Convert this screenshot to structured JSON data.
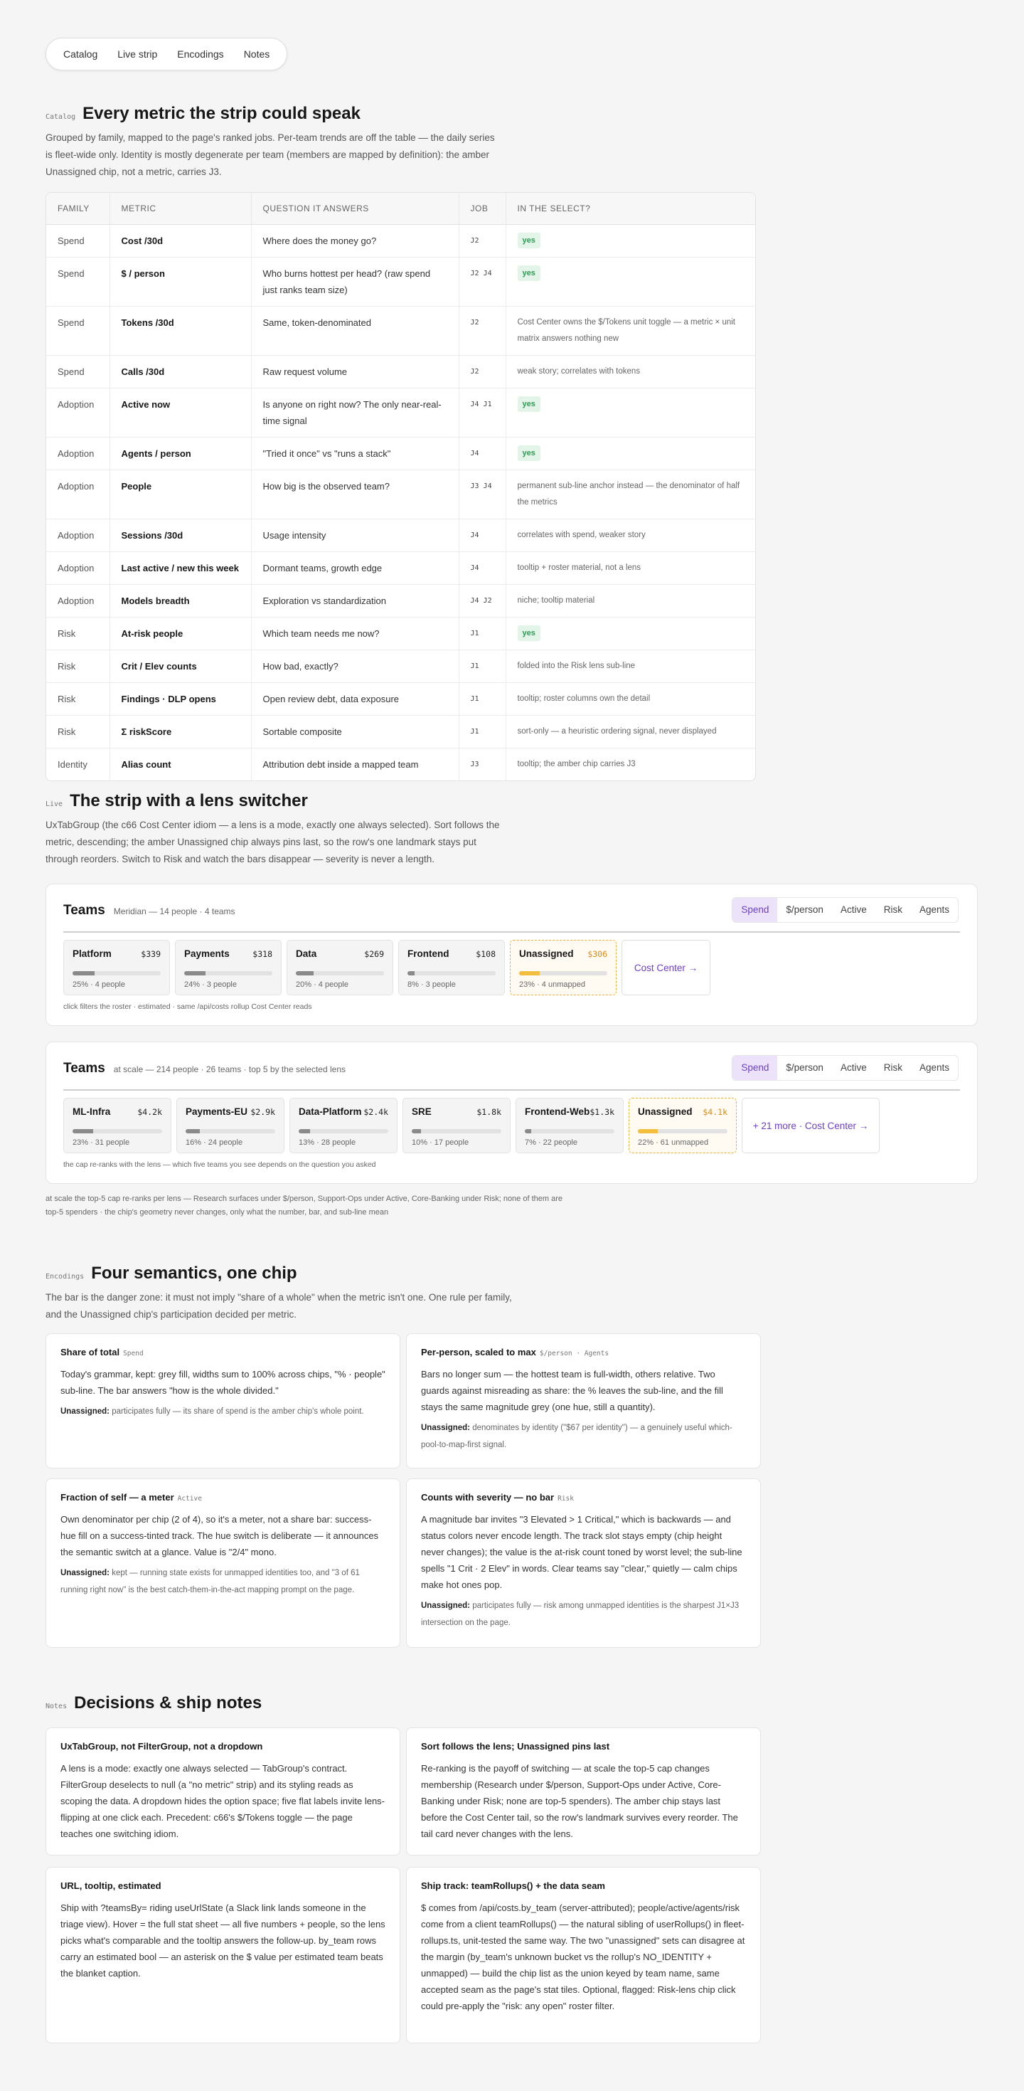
{
  "nav": [
    "Catalog",
    "Live strip",
    "Encodings",
    "Notes"
  ],
  "catalog": {
    "eyebrow": "Catalog",
    "title": "Every metric the strip could speak",
    "desc": "Grouped by family, mapped to the page's ranked jobs. Per-team trends are off the table — the daily series is fleet-wide only. Identity is mostly degenerate per team (members are mapped by definition): the amber Unassigned chip, not a metric, carries J3.",
    "headers": [
      "Family",
      "Metric",
      "Question it answers",
      "Job",
      "In the select?"
    ],
    "rows": [
      {
        "family": "Spend",
        "metric": "Cost /30d",
        "question": "Where does the money go?",
        "job": "J2",
        "select": "yes",
        "yes": true
      },
      {
        "family": "Spend",
        "metric": "$ / person",
        "question": "Who burns hottest per head? (raw spend just ranks team size)",
        "job": "J2 J4",
        "select": "yes",
        "yes": true
      },
      {
        "family": "Spend",
        "metric": "Tokens /30d",
        "question": "Same, token-denominated",
        "job": "J2",
        "select": "Cost Center owns the $/Tokens unit toggle — a metric × unit matrix answers nothing new",
        "yes": false
      },
      {
        "family": "Spend",
        "metric": "Calls /30d",
        "question": "Raw request volume",
        "job": "J2",
        "select": "weak story; correlates with tokens",
        "yes": false
      },
      {
        "family": "Adoption",
        "metric": "Active now",
        "question": "Is anyone on right now? The only near-real-time signal",
        "job": "J4 J1",
        "select": "yes",
        "yes": true
      },
      {
        "family": "Adoption",
        "metric": "Agents / person",
        "question": "\"Tried it once\" vs \"runs a stack\"",
        "job": "J4",
        "select": "yes",
        "yes": true
      },
      {
        "family": "Adoption",
        "metric": "People",
        "question": "How big is the observed team?",
        "job": "J3 J4",
        "select": "permanent sub-line anchor instead — the denominator of half the metrics",
        "yes": false
      },
      {
        "family": "Adoption",
        "metric": "Sessions /30d",
        "question": "Usage intensity",
        "job": "J4",
        "select": "correlates with spend, weaker story",
        "yes": false
      },
      {
        "family": "Adoption",
        "metric": "Last active / new this week",
        "question": "Dormant teams, growth edge",
        "job": "J4",
        "select": "tooltip + roster material, not a lens",
        "yes": false
      },
      {
        "family": "Adoption",
        "metric": "Models breadth",
        "question": "Exploration vs standardization",
        "job": "J4 J2",
        "select": "niche; tooltip material",
        "yes": false
      },
      {
        "family": "Risk",
        "metric": "At-risk people",
        "question": "Which team needs me now?",
        "job": "J1",
        "select": "yes",
        "yes": true
      },
      {
        "family": "Risk",
        "metric": "Crit / Elev counts",
        "question": "How bad, exactly?",
        "job": "J1",
        "select": "folded into the Risk lens sub-line",
        "yes": false
      },
      {
        "family": "Risk",
        "metric": "Findings · DLP opens",
        "question": "Open review debt, data exposure",
        "job": "J1",
        "select": "tooltip; roster columns own the detail",
        "yes": false
      },
      {
        "family": "Risk",
        "metric": "Σ riskScore",
        "question": "Sortable composite",
        "job": "J1",
        "select": "sort-only — a heuristic ordering signal, never displayed",
        "yes": false
      },
      {
        "family": "Identity",
        "metric": "Alias count",
        "question": "Attribution debt inside a mapped team",
        "job": "J3",
        "select": "tooltip; the amber chip carries J3",
        "yes": false
      }
    ]
  },
  "live": {
    "eyebrow": "Live",
    "title": "The strip with a lens switcher",
    "desc": "UxTabGroup (the c66 Cost Center idiom — a lens is a mode, exactly one always selected). Sort follows the metric, descending; the amber Unassigned chip always pins last, so the row's one landmark stays put through reorders. Switch to Risk and watch the bars disappear — severity is never a length.",
    "lenses": [
      "Spend",
      "$/person",
      "Active",
      "Risk",
      "Agents"
    ],
    "strip1": {
      "title": "Teams",
      "subtitle": "Meridian — 14 people · 4 teams",
      "chips": [
        {
          "name": "Platform",
          "value": "$339",
          "fill": 25,
          "sub": "25% · 4 people"
        },
        {
          "name": "Payments",
          "value": "$318",
          "fill": 24,
          "sub": "24% · 3 people"
        },
        {
          "name": "Data",
          "value": "$269",
          "fill": 20,
          "sub": "20% · 4 people"
        },
        {
          "name": "Frontend",
          "value": "$108",
          "fill": 8,
          "sub": "8% · 3 people"
        }
      ],
      "unassigned": {
        "name": "Unassigned",
        "value": "$306",
        "fill": 23,
        "sub": "23% · 4 unmapped"
      },
      "tail": "Cost Center →",
      "foot": "click filters the roster · estimated · same /api/costs rollup Cost Center reads"
    },
    "strip2": {
      "title": "Teams",
      "subtitle": "at scale — 214 people · 26 teams · top 5 by the selected lens",
      "chips": [
        {
          "name": "ML-Infra",
          "value": "$4.2k",
          "fill": 23,
          "sub": "23% · 31 people"
        },
        {
          "name": "Payments-EU",
          "value": "$2.9k",
          "fill": 16,
          "sub": "16% · 24 people"
        },
        {
          "name": "Data-Platform",
          "value": "$2.4k",
          "fill": 13,
          "sub": "13% · 28 people"
        },
        {
          "name": "SRE",
          "value": "$1.8k",
          "fill": 10,
          "sub": "10% · 17 people"
        },
        {
          "name": "Frontend-Web",
          "value": "$1.3k",
          "fill": 7,
          "sub": "7% · 22 people"
        }
      ],
      "unassigned": {
        "name": "Unassigned",
        "value": "$4.1k",
        "fill": 22,
        "sub": "22% · 61 unmapped"
      },
      "tail": "+ 21 more · Cost Center →",
      "foot": "the cap re-ranks with the lens — which five teams you see depends on the question you asked"
    },
    "caption": "at scale the top-5 cap re-ranks per lens — Research surfaces under $/person, Support-Ops under Active, Core-Banking under Risk; none of them are top-5 spenders · the chip's geometry never changes, only what the number, bar, and sub-line mean"
  },
  "encodings": {
    "eyebrow": "Encodings",
    "title": "Four semantics, one chip",
    "desc": "The bar is the danger zone: it must not imply \"share of a whole\" when the metric isn't one. One rule per family, and the Unassigned chip's participation decided per metric.",
    "unassigned_label": "Unassigned:",
    "cards": [
      {
        "title": "Share of total",
        "tag": "Spend",
        "body": "Today's grammar, kept: grey fill, widths sum to 100% across chips, \"% · people\" sub-line. The bar answers \"how is the whole divided.\"",
        "un": "participates fully — its share of spend is the amber chip's whole point."
      },
      {
        "title": "Per-person, scaled to max",
        "tag": "$/person · Agents",
        "body": "Bars no longer sum — the hottest team is full-width, others relative. Two guards against misreading as share: the % leaves the sub-line, and the fill stays the same magnitude grey (one hue, still a quantity).",
        "un": "denominates by identity (\"$67 per identity\") — a genuinely useful which-pool-to-map-first signal."
      },
      {
        "title": "Fraction of self — a meter",
        "tag": "Active",
        "body": "Own denominator per chip (2 of 4), so it's a meter, not a share bar: success-hue fill on a success-tinted track. The hue switch is deliberate — it announces the semantic switch at a glance. Value is \"2/4\" mono.",
        "un": "kept — running state exists for unmapped identities too, and \"3 of 61 running right now\" is the best catch-them-in-the-act mapping prompt on the page."
      },
      {
        "title": "Counts with severity — no bar",
        "tag": "Risk",
        "body": "A magnitude bar invites \"3 Elevated > 1 Critical,\" which is backwards — and status colors never encode length. The track slot stays empty (chip height never changes); the value is the at-risk count toned by worst level; the sub-line spells \"1 Crit · 2 Elev\" in words. Clear teams say \"clear,\" quietly — calm chips make hot ones pop.",
        "un": "participates fully — risk among unmapped identities is the sharpest J1×J3 intersection on the page."
      }
    ]
  },
  "notes": {
    "eyebrow": "Notes",
    "title": "Decisions & ship notes",
    "cards": [
      {
        "title": "UxTabGroup, not FilterGroup, not a dropdown",
        "body": "A lens is a mode: exactly one always selected — TabGroup's contract. FilterGroup deselects to null (a \"no metric\" strip) and its styling reads as scoping the data. A dropdown hides the option space; five flat labels invite lens-flipping at one click each. Precedent: c66's $/Tokens toggle — the page teaches one switching idiom."
      },
      {
        "title": "Sort follows the lens; Unassigned pins last",
        "body": "Re-ranking is the payoff of switching — at scale the top-5 cap changes membership (Research under $/person, Support-Ops under Active, Core-Banking under Risk; none are top-5 spenders). The amber chip stays last before the Cost Center tail, so the row's landmark survives every reorder. The tail card never changes with the lens."
      },
      {
        "title": "URL, tooltip, estimated",
        "body": "Ship with ?teamsBy= riding useUrlState (a Slack link lands someone in the triage view). Hover = the full stat sheet — all five numbers + people, so the lens picks what's comparable and the tooltip answers the follow-up. by_team rows carry an estimated bool — an asterisk on the $ value per estimated team beats the blanket caption."
      },
      {
        "title": "Ship track: teamRollups() + the data seam",
        "body": "$ comes from /api/costs.by_team (server-attributed); people/active/agents/risk come from a client teamRollups() — the natural sibling of userRollups() in fleet-rollups.ts, unit-tested the same way. The two \"unassigned\" sets can disagree at the margin (by_team's unknown bucket vs the rollup's NO_IDENTITY + unmapped) — build the chip list as the union keyed by team name, same accepted seam as the page's stat tiles. Optional, flagged: Risk-lens chip click could pre-apply the \"risk: any open\" roster filter."
      }
    ]
  },
  "colors": {
    "accent": "#6d3fc9",
    "amber": "#e8b230",
    "success": "#2e9b54"
  }
}
